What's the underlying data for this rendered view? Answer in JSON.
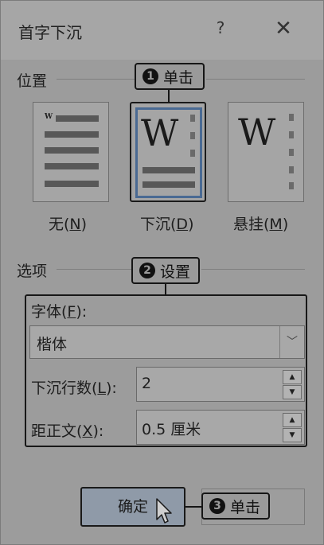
{
  "dialog": {
    "title": "首字下沉",
    "help_label": "?",
    "close_label": "✕"
  },
  "position_section": {
    "label": "位置",
    "options": [
      {
        "label": "无(",
        "mnemonic": "N",
        "tail": ")",
        "selected": false
      },
      {
        "label": "下沉(",
        "mnemonic": "D",
        "tail": ")",
        "selected": true
      },
      {
        "label": "悬挂(",
        "mnemonic": "M",
        "tail": ")",
        "selected": false
      }
    ],
    "sample_letter": "W"
  },
  "options_section": {
    "label": "选项",
    "font_label": "字体(",
    "font_mnemonic": "F",
    "font_tail": "):",
    "font_value": "楷体",
    "lines_label": "下沉行数(",
    "lines_mnemonic": "L",
    "lines_tail": "):",
    "lines_value": "2",
    "distance_label": "距正文(",
    "distance_mnemonic": "X",
    "distance_tail": "):",
    "distance_value": "0.5 厘米"
  },
  "buttons": {
    "ok_label": "确定",
    "cancel_label": ""
  },
  "callouts": [
    {
      "number": "1",
      "text": "单击"
    },
    {
      "number": "2",
      "text": "设置"
    },
    {
      "number": "3",
      "text": "单击"
    }
  ],
  "colors": {
    "selection_blue": "#4a6a93",
    "callout_border": "#161616"
  }
}
